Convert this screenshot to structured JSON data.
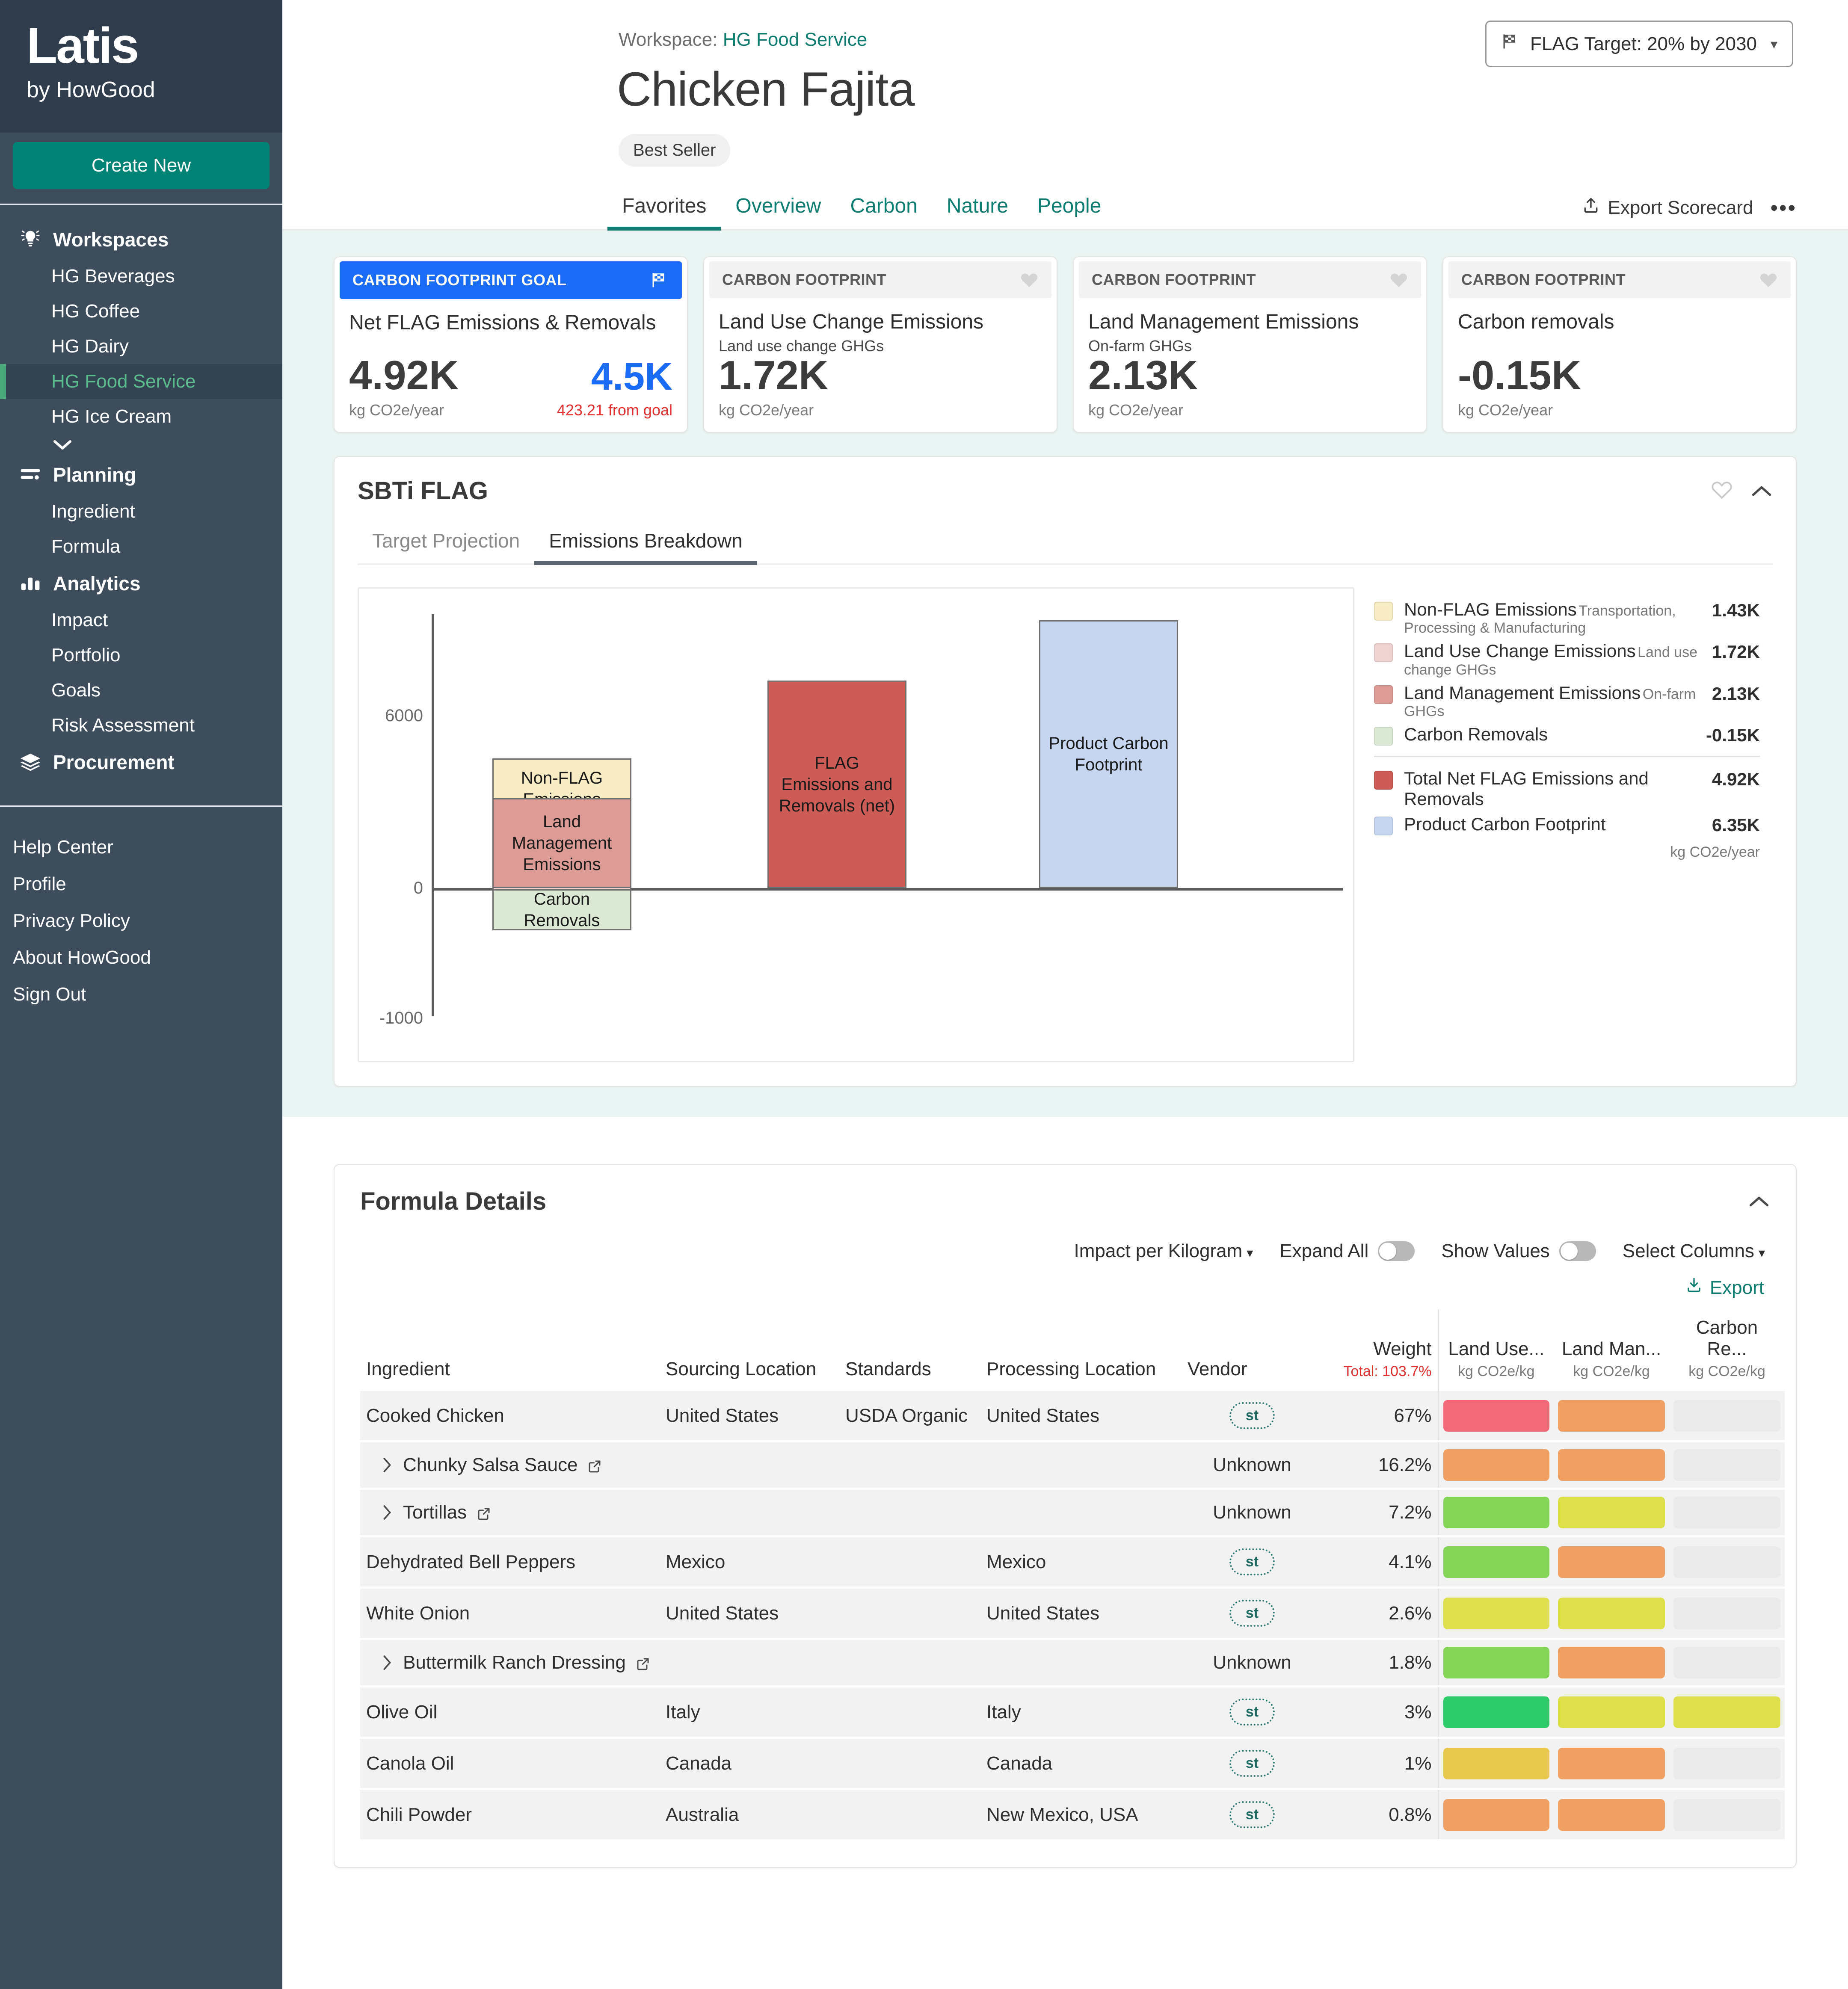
{
  "sidebar": {
    "brand": {
      "title": "Latis",
      "subtitle": "by HowGood"
    },
    "create_label": "Create New",
    "groups": [
      {
        "label": "Workspaces",
        "icon": "lightbulb-icon",
        "items": [
          "HG Beverages",
          "HG Coffee",
          "HG Dairy",
          "HG Food Service",
          "HG Ice Cream"
        ],
        "active": "HG Food Service",
        "has_more": true
      },
      {
        "label": "Planning",
        "icon": "list-icon",
        "items": [
          "Ingredient",
          "Formula"
        ]
      },
      {
        "label": "Analytics",
        "icon": "bar-chart-icon",
        "items": [
          "Impact",
          "Portfolio",
          "Goals",
          "Risk Assessment"
        ]
      },
      {
        "label": "Procurement",
        "icon": "layers-icon",
        "items": []
      }
    ],
    "footer_links": [
      "Help Center",
      "Profile",
      "Privacy Policy",
      "About HowGood",
      "Sign Out"
    ]
  },
  "header": {
    "breadcrumb_prefix": "Workspace:",
    "workspace": "HG Food Service",
    "title": "Chicken Fajita",
    "badge": "Best Seller",
    "flag_target": "FLAG Target: 20% by 2030",
    "flag_target_icon": "checkered-flag-icon",
    "tabs": [
      {
        "label": "Favorites",
        "active": true
      },
      {
        "label": "Overview",
        "active": false
      },
      {
        "label": "Carbon",
        "active": false
      },
      {
        "label": "Nature",
        "active": false
      },
      {
        "label": "People",
        "active": false
      }
    ],
    "export_scorecard": "Export Scorecard",
    "more_menu": "•••"
  },
  "kpis": [
    {
      "eyebrow": "CARBON FOOTPRINT GOAL",
      "style": "goal",
      "icon": "checkered-flag-icon",
      "name": "Net FLAG Emissions & Removals",
      "sub": "",
      "value": "4.92K",
      "unit": "kg CO2e/year",
      "goal_value": "4.5K",
      "goal_sub": "423.21 from goal"
    },
    {
      "eyebrow": "CARBON FOOTPRINT",
      "style": "plain",
      "icon": "heart-icon",
      "name": "Land Use Change Emissions",
      "sub": "Land use change GHGs",
      "value": "1.72K",
      "unit": "kg CO2e/year",
      "goal_value": "",
      "goal_sub": ""
    },
    {
      "eyebrow": "CARBON FOOTPRINT",
      "style": "plain",
      "icon": "heart-icon",
      "name": "Land Management Emissions",
      "sub": "On-farm GHGs",
      "value": "2.13K",
      "unit": "kg CO2e/year",
      "goal_value": "",
      "goal_sub": ""
    },
    {
      "eyebrow": "CARBON FOOTPRINT",
      "style": "plain",
      "icon": "heart-icon",
      "name": "Carbon removals",
      "sub": "",
      "value": "-0.15K",
      "unit": "kg CO2e/year",
      "goal_value": "",
      "goal_sub": ""
    }
  ],
  "flag_card": {
    "title": "SBTi FLAG",
    "favorite_icon": "heart-icon",
    "collapse_icon": "chevron-up-icon",
    "tabs": [
      {
        "label": "Target Projection",
        "active": false
      },
      {
        "label": "Emissions Breakdown",
        "active": true
      }
    ],
    "legend_unit": "kg CO2e/year",
    "legend": [
      {
        "label": "Non-FLAG Emissions",
        "desc": "Transportation, Processing & Manufacturing",
        "value": "1.43K",
        "color": "#f7ecc3"
      },
      {
        "label": "Land Use Change Emissions",
        "desc": "Land use change GHGs",
        "value": "1.72K",
        "color": "#efd3d2"
      },
      {
        "label": "Land Management Emissions",
        "desc": "On-farm GHGs",
        "value": "2.13K",
        "color": "#dd9b95"
      },
      {
        "label": "Carbon Removals",
        "desc": "",
        "value": "-0.15K",
        "color": "#dbe9d4"
      }
    ],
    "legend_totals": [
      {
        "label": "Total Net FLAG Emissions and Removals",
        "value": "4.92K",
        "color": "#cd5b56"
      },
      {
        "label": "Product Carbon Footprint",
        "value": "6.35K",
        "color": "#c6d6f0"
      }
    ]
  },
  "chart_data": {
    "type": "bar",
    "title": "Emissions Breakdown",
    "xlabel": "",
    "ylabel": "",
    "ylim": [
      -1000,
      7500
    ],
    "yticks": [
      6000,
      0,
      -1000
    ],
    "ytick_labels": [
      "6000",
      "0",
      "-1000"
    ],
    "grid": false,
    "legend_position": "right",
    "unit": "kg CO2e/year",
    "stacked_bar": {
      "name": "Breakdown",
      "segments": [
        {
          "label": "Non-FLAG Emissions",
          "value": 1430,
          "color": "#f7ecc3"
        },
        {
          "label": "Land Use Change Emissions",
          "value": 1720,
          "color": "#efd3d2"
        },
        {
          "label": "Land Management Emissions",
          "value": 2130,
          "color": "#dd9b95"
        },
        {
          "label": "Carbon Removals",
          "value": -150,
          "color": "#dbe9d4"
        }
      ]
    },
    "bars": [
      {
        "label": "FLAG Emissions and Removals (net)",
        "value": 4920,
        "color": "#cd5b56"
      },
      {
        "label": "Product Carbon Footprint",
        "value": 6350,
        "color": "#c6d6f0"
      }
    ]
  },
  "formula": {
    "title": "Formula Details",
    "collapse_icon": "chevron-up-icon",
    "toolbar": {
      "impact_per": "Impact per Kilogram",
      "expand_all": "Expand All",
      "expand_all_on": false,
      "show_values": "Show Values",
      "show_values_on": false,
      "select_columns": "Select Columns",
      "export": "Export"
    },
    "columns": [
      {
        "key": "ingredient",
        "label": "Ingredient",
        "sub": ""
      },
      {
        "key": "sourcing",
        "label": "Sourcing Location",
        "sub": ""
      },
      {
        "key": "standards",
        "label": "Standards",
        "sub": ""
      },
      {
        "key": "processing",
        "label": "Processing Location",
        "sub": ""
      },
      {
        "key": "vendor",
        "label": "Vendor",
        "sub": ""
      },
      {
        "key": "weight",
        "label": "Weight",
        "sub": "Total: 103.7%"
      },
      {
        "key": "land_use",
        "label": "Land Use...",
        "sub": "kg CO2e/kg"
      },
      {
        "key": "land_man",
        "label": "Land Man...",
        "sub": "kg CO2e/kg"
      },
      {
        "key": "carbon_re",
        "label": "Carbon Re...",
        "sub": "kg CO2e/kg"
      }
    ],
    "rows": [
      {
        "ingredient": "Cooked Chicken",
        "expandable": false,
        "link": false,
        "sourcing": "United States",
        "standards": "USDA Organic",
        "processing": "United States",
        "vendor": "st",
        "vendor_type": "chip",
        "weight": "67%",
        "land_use": "#f4697a",
        "land_man": "#f0a062",
        "carbon_re": ""
      },
      {
        "ingredient": "Chunky Salsa Sauce",
        "expandable": true,
        "link": true,
        "sourcing": "",
        "standards": "",
        "processing": "",
        "vendor": "Unknown",
        "vendor_type": "text",
        "weight": "16.2%",
        "land_use": "#f0a062",
        "land_man": "#f0a062",
        "carbon_re": ""
      },
      {
        "ingredient": "Tortillas",
        "expandable": true,
        "link": true,
        "sourcing": "",
        "standards": "",
        "processing": "",
        "vendor": "Unknown",
        "vendor_type": "text",
        "weight": "7.2%",
        "land_use": "#84d457",
        "land_man": "#dde04a",
        "carbon_re": ""
      },
      {
        "ingredient": "Dehydrated Bell Peppers",
        "expandable": false,
        "link": false,
        "sourcing": "Mexico",
        "standards": "",
        "processing": "Mexico",
        "vendor": "st",
        "vendor_type": "chip",
        "weight": "4.1%",
        "land_use": "#84d457",
        "land_man": "#f0a062",
        "carbon_re": ""
      },
      {
        "ingredient": "White Onion",
        "expandable": false,
        "link": false,
        "sourcing": "United States",
        "standards": "",
        "processing": "United States",
        "vendor": "st",
        "vendor_type": "chip",
        "weight": "2.6%",
        "land_use": "#dde04a",
        "land_man": "#dde04a",
        "carbon_re": ""
      },
      {
        "ingredient": "Buttermilk Ranch Dressing",
        "expandable": true,
        "link": true,
        "sourcing": "",
        "standards": "",
        "processing": "",
        "vendor": "Unknown",
        "vendor_type": "text",
        "weight": "1.8%",
        "land_use": "#84d457",
        "land_man": "#f0a062",
        "carbon_re": ""
      },
      {
        "ingredient": "Olive Oil",
        "expandable": false,
        "link": false,
        "sourcing": "Italy",
        "standards": "",
        "processing": "Italy",
        "vendor": "st",
        "vendor_type": "chip",
        "weight": "3%",
        "land_use": "#2ecb6a",
        "land_man": "#dde04a",
        "carbon_re": "#dde04a"
      },
      {
        "ingredient": "Canola Oil",
        "expandable": false,
        "link": false,
        "sourcing": "Canada",
        "standards": "",
        "processing": "Canada",
        "vendor": "st",
        "vendor_type": "chip",
        "weight": "1%",
        "land_use": "#e8c84a",
        "land_man": "#f0a062",
        "carbon_re": ""
      },
      {
        "ingredient": "Chili Powder",
        "expandable": false,
        "link": false,
        "sourcing": "Australia",
        "standards": "",
        "processing": "New Mexico, USA",
        "vendor": "st",
        "vendor_type": "chip",
        "weight": "0.8%",
        "land_use": "#f0a062",
        "land_man": "#f0a062",
        "carbon_re": ""
      }
    ]
  }
}
